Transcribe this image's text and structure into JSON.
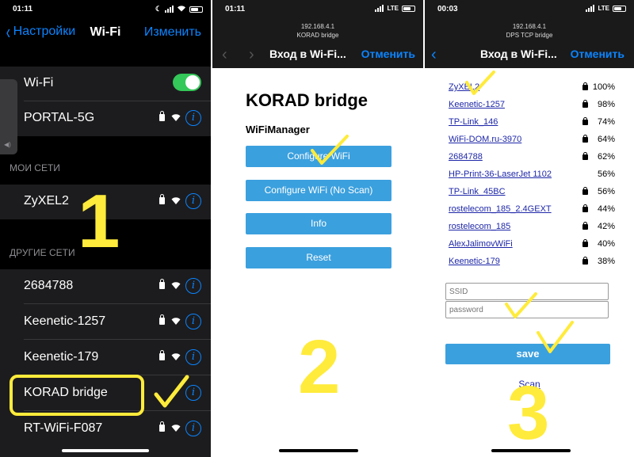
{
  "panel1": {
    "status": {
      "time": "01:11"
    },
    "nav": {
      "back_label": "Настройки",
      "title": "Wi-Fi",
      "edit_label": "Изменить"
    },
    "wifi_row": {
      "label": "Wi-Fi",
      "enabled": true
    },
    "current_network": "PORTAL-5G",
    "my_networks_header": "МОИ СЕТИ",
    "my_networks": [
      "ZyXEL2"
    ],
    "other_networks_header": "ДРУГИЕ СЕТИ",
    "other_networks": [
      "2684788",
      "Keenetic-1257",
      "Keenetic-179",
      "KORAD bridge",
      "RT-WiFi-F087"
    ],
    "highlighted_network": "KORAD bridge",
    "step_number": "1"
  },
  "panel2": {
    "status": {
      "time": "01:11",
      "network": "LTE"
    },
    "url_line1": "192.168.4.1",
    "url_line2": "KORAD bridge",
    "nav_title": "Вход в Wi-Fi...",
    "cancel_label": "Отменить",
    "page_title": "KORAD bridge",
    "subtitle": "WiFiManager",
    "buttons": [
      "Configure WiFi",
      "Configure WiFi (No Scan)",
      "Info",
      "Reset"
    ],
    "step_number": "2"
  },
  "panel3": {
    "status": {
      "time": "00:03",
      "network": "LTE"
    },
    "url_line1": "192.168.4.1",
    "url_line2": "DPS TCP bridge",
    "nav_title": "Вход в Wi-Fi...",
    "cancel_label": "Отменить",
    "networks": [
      {
        "name": "ZyXEL2",
        "locked": true,
        "signal": "100%"
      },
      {
        "name": "Keenetic-1257",
        "locked": true,
        "signal": "98%"
      },
      {
        "name": "TP-Link_146",
        "locked": true,
        "signal": "74%"
      },
      {
        "name": "WiFi-DOM.ru-3970",
        "locked": true,
        "signal": "64%"
      },
      {
        "name": "2684788",
        "locked": true,
        "signal": "62%"
      },
      {
        "name": "HP-Print-36-LaserJet 1102",
        "locked": false,
        "signal": "56%"
      },
      {
        "name": "TP-Link_45BC",
        "locked": true,
        "signal": "56%"
      },
      {
        "name": "rostelecom_185_2.4GEXT",
        "locked": true,
        "signal": "44%"
      },
      {
        "name": "rostelecom_185",
        "locked": true,
        "signal": "42%"
      },
      {
        "name": "AlexJalimovWiFi",
        "locked": true,
        "signal": "40%"
      },
      {
        "name": "Keenetic-179",
        "locked": true,
        "signal": "38%"
      }
    ],
    "ssid_placeholder": "SSID",
    "password_placeholder": "password",
    "save_label": "save",
    "scan_label": "Scan",
    "step_number": "3"
  },
  "colors": {
    "ios_blue": "#0a84ff",
    "toggle_green": "#34c759",
    "button_blue": "#3ba0de",
    "annotation_yellow": "#ffeb3b",
    "link_blue": "#1e27a8"
  },
  "icons": [
    "back-chevron-icon",
    "lock-icon",
    "wifi-icon",
    "info-icon",
    "moon-icon",
    "battery-icon",
    "signal-icon",
    "checkmark-icon"
  ]
}
